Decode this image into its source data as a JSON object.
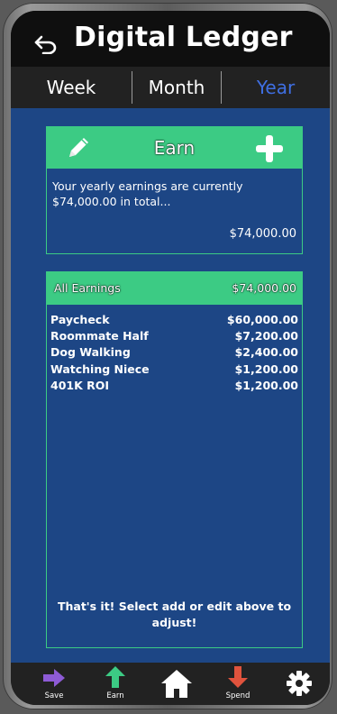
{
  "header": {
    "title": "Digital Ledger"
  },
  "tabs": [
    {
      "label": "Week"
    },
    {
      "label": "Month"
    },
    {
      "label": "Year"
    }
  ],
  "active_tab": "Year",
  "earn_card": {
    "title": "Earn",
    "description": "Your yearly earnings are currently $74,000.00 in total...",
    "total": "$74,000.00"
  },
  "earnings_list": {
    "header_label": "All Earnings",
    "header_amount": "$74,000.00",
    "items": [
      {
        "name": "Paycheck",
        "amount": "$60,000.00"
      },
      {
        "name": "Roommate Half",
        "amount": "$7,200.00"
      },
      {
        "name": "Dog Walking",
        "amount": "$2,400.00"
      },
      {
        "name": "Watching Niece",
        "amount": "$1,200.00"
      },
      {
        "name": "401K ROI",
        "amount": "$1,200.00"
      }
    ],
    "footer_note": "That's it! Select add or edit above to adjust!"
  },
  "bottom_nav": [
    {
      "label": "Save",
      "icon": "arrow-right-icon",
      "color": "#8e5bd6"
    },
    {
      "label": "Earn",
      "icon": "arrow-up-icon",
      "color": "#3ccb84"
    },
    {
      "label": "",
      "icon": "home-icon",
      "color": "#ffffff"
    },
    {
      "label": "Spend",
      "icon": "arrow-down-icon",
      "color": "#e0533d"
    },
    {
      "label": "",
      "icon": "gear-icon",
      "color": "#ffffff"
    }
  ],
  "colors": {
    "accent_green": "#3ccb84",
    "background_blue": "#1d4685",
    "active_tab": "#3f6fe3",
    "bar": "#222222"
  }
}
